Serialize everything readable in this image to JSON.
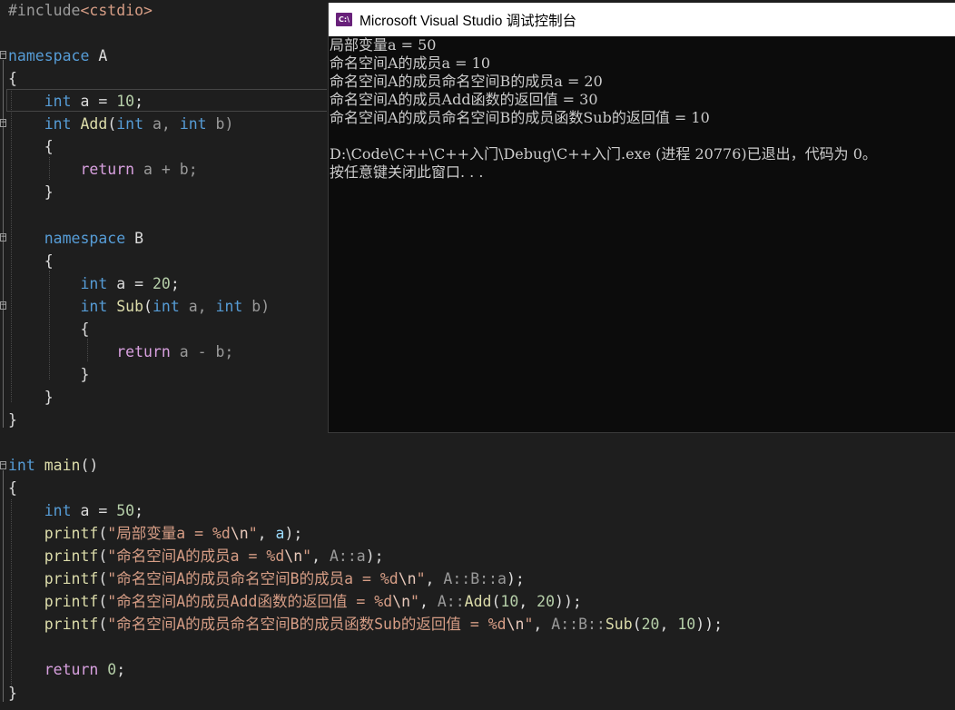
{
  "editor": {
    "lines": [
      [
        {
          "t": "#include",
          "c": "pp"
        },
        {
          "t": "<cstdio>",
          "c": "inc"
        }
      ],
      [],
      [
        {
          "t": "namespace",
          "c": "kw"
        },
        {
          "t": " A",
          "c": "id"
        }
      ],
      [
        {
          "t": "{",
          "c": "id"
        }
      ],
      [
        {
          "t": "    ",
          "c": "id"
        },
        {
          "t": "int",
          "c": "kw"
        },
        {
          "t": " a = ",
          "c": "id"
        },
        {
          "t": "10",
          "c": "num"
        },
        {
          "t": ";",
          "c": "id"
        }
      ],
      [
        {
          "t": "    ",
          "c": "id"
        },
        {
          "t": "int",
          "c": "kw"
        },
        {
          "t": " ",
          "c": "id"
        },
        {
          "t": "Add",
          "c": "fn"
        },
        {
          "t": "(",
          "c": "id"
        },
        {
          "t": "int",
          "c": "kw"
        },
        {
          "t": " a, ",
          "c": "par"
        },
        {
          "t": "int",
          "c": "kw"
        },
        {
          "t": " b)",
          "c": "par"
        }
      ],
      [
        {
          "t": "    {",
          "c": "id"
        }
      ],
      [
        {
          "t": "        ",
          "c": "id"
        },
        {
          "t": "return",
          "c": "ret"
        },
        {
          "t": " a + b;",
          "c": "par"
        }
      ],
      [
        {
          "t": "    }",
          "c": "id"
        }
      ],
      [],
      [
        {
          "t": "    ",
          "c": "id"
        },
        {
          "t": "namespace",
          "c": "kw"
        },
        {
          "t": " B",
          "c": "id"
        }
      ],
      [
        {
          "t": "    {",
          "c": "id"
        }
      ],
      [
        {
          "t": "        ",
          "c": "id"
        },
        {
          "t": "int",
          "c": "kw"
        },
        {
          "t": " a = ",
          "c": "id"
        },
        {
          "t": "20",
          "c": "num"
        },
        {
          "t": ";",
          "c": "id"
        }
      ],
      [
        {
          "t": "        ",
          "c": "id"
        },
        {
          "t": "int",
          "c": "kw"
        },
        {
          "t": " ",
          "c": "id"
        },
        {
          "t": "Sub",
          "c": "fn"
        },
        {
          "t": "(",
          "c": "id"
        },
        {
          "t": "int",
          "c": "kw"
        },
        {
          "t": " a, ",
          "c": "par"
        },
        {
          "t": "int",
          "c": "kw"
        },
        {
          "t": " b)",
          "c": "par"
        }
      ],
      [
        {
          "t": "        {",
          "c": "id"
        }
      ],
      [
        {
          "t": "            ",
          "c": "id"
        },
        {
          "t": "return",
          "c": "ret"
        },
        {
          "t": " a - b;",
          "c": "par"
        }
      ],
      [
        {
          "t": "        }",
          "c": "id"
        }
      ],
      [
        {
          "t": "    }",
          "c": "id"
        }
      ],
      [
        {
          "t": "}",
          "c": "id"
        }
      ],
      [],
      [
        {
          "t": "int",
          "c": "kw"
        },
        {
          "t": " ",
          "c": "id"
        },
        {
          "t": "main",
          "c": "fn"
        },
        {
          "t": "()",
          "c": "id"
        }
      ],
      [
        {
          "t": "{",
          "c": "id"
        }
      ],
      [
        {
          "t": "    ",
          "c": "id"
        },
        {
          "t": "int",
          "c": "kw"
        },
        {
          "t": " a = ",
          "c": "id"
        },
        {
          "t": "50",
          "c": "num"
        },
        {
          "t": ";",
          "c": "id"
        }
      ],
      [
        {
          "t": "    ",
          "c": "id"
        },
        {
          "t": "printf",
          "c": "fn"
        },
        {
          "t": "(",
          "c": "id"
        },
        {
          "t": "\"局部变量a = %d",
          "c": "str"
        },
        {
          "t": "\\n",
          "c": "esc"
        },
        {
          "t": "\"",
          "c": "str"
        },
        {
          "t": ", ",
          "c": "id"
        },
        {
          "t": "a",
          "c": "var"
        },
        {
          "t": ");",
          "c": "id"
        }
      ],
      [
        {
          "t": "    ",
          "c": "id"
        },
        {
          "t": "printf",
          "c": "fn"
        },
        {
          "t": "(",
          "c": "id"
        },
        {
          "t": "\"命名空间A的成员a = %d",
          "c": "str"
        },
        {
          "t": "\\n",
          "c": "esc"
        },
        {
          "t": "\"",
          "c": "str"
        },
        {
          "t": ", ",
          "c": "id"
        },
        {
          "t": "A::a",
          "c": "par"
        },
        {
          "t": ");",
          "c": "id"
        }
      ],
      [
        {
          "t": "    ",
          "c": "id"
        },
        {
          "t": "printf",
          "c": "fn"
        },
        {
          "t": "(",
          "c": "id"
        },
        {
          "t": "\"命名空间A的成员命名空间B的成员a = %d",
          "c": "str"
        },
        {
          "t": "\\n",
          "c": "esc"
        },
        {
          "t": "\"",
          "c": "str"
        },
        {
          "t": ", ",
          "c": "id"
        },
        {
          "t": "A::B::a",
          "c": "par"
        },
        {
          "t": ");",
          "c": "id"
        }
      ],
      [
        {
          "t": "    ",
          "c": "id"
        },
        {
          "t": "printf",
          "c": "fn"
        },
        {
          "t": "(",
          "c": "id"
        },
        {
          "t": "\"命名空间A的成员Add函数的返回值 = %d",
          "c": "str"
        },
        {
          "t": "\\n",
          "c": "esc"
        },
        {
          "t": "\"",
          "c": "str"
        },
        {
          "t": ", ",
          "c": "id"
        },
        {
          "t": "A::",
          "c": "par"
        },
        {
          "t": "Add",
          "c": "fn"
        },
        {
          "t": "(",
          "c": "id"
        },
        {
          "t": "10",
          "c": "num"
        },
        {
          "t": ", ",
          "c": "id"
        },
        {
          "t": "20",
          "c": "num"
        },
        {
          "t": "));",
          "c": "id"
        }
      ],
      [
        {
          "t": "    ",
          "c": "id"
        },
        {
          "t": "printf",
          "c": "fn"
        },
        {
          "t": "(",
          "c": "id"
        },
        {
          "t": "\"命名空间A的成员命名空间B的成员函数Sub的返回值 = %d",
          "c": "str"
        },
        {
          "t": "\\n",
          "c": "esc"
        },
        {
          "t": "\"",
          "c": "str"
        },
        {
          "t": ", ",
          "c": "id"
        },
        {
          "t": "A::B::",
          "c": "par"
        },
        {
          "t": "Sub",
          "c": "fn"
        },
        {
          "t": "(",
          "c": "id"
        },
        {
          "t": "20",
          "c": "num"
        },
        {
          "t": ", ",
          "c": "id"
        },
        {
          "t": "10",
          "c": "num"
        },
        {
          "t": "));",
          "c": "id"
        }
      ],
      [],
      [
        {
          "t": "    ",
          "c": "id"
        },
        {
          "t": "return",
          "c": "ret"
        },
        {
          "t": " ",
          "c": "id"
        },
        {
          "t": "0",
          "c": "num"
        },
        {
          "t": ";",
          "c": "id"
        }
      ],
      [
        {
          "t": "}",
          "c": "id"
        }
      ]
    ]
  },
  "console": {
    "icon_text": "C:\\",
    "title": "Microsoft Visual Studio 调试控制台",
    "output": [
      "局部变量a = 50",
      "命名空间A的成员a = 10",
      "命名空间A的成员命名空间B的成员a = 20",
      "命名空间A的成员Add函数的返回值 = 30",
      "命名空间A的成员命名空间B的成员函数Sub的返回值 = 10",
      "",
      "D:\\Code\\C++\\C++入门\\Debug\\C++入门.exe (进程 20776)已退出，代码为 0。",
      "按任意键关闭此窗口. . ."
    ]
  }
}
